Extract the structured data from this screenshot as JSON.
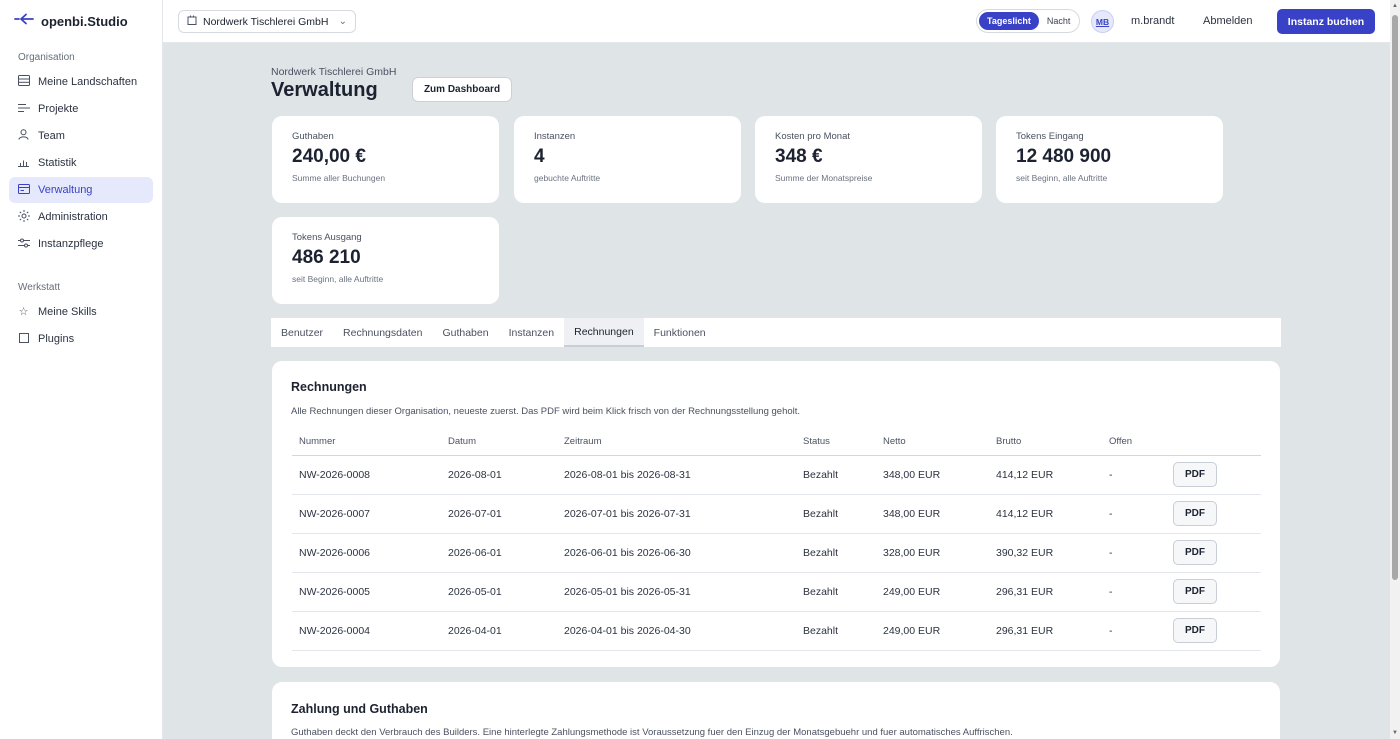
{
  "brand": {
    "logo_icon": "openbi-logo-icon",
    "name": "openbi.Studio"
  },
  "sidebar": {
    "section_org": "Organisation",
    "org_items": [
      {
        "label": "Meine Landschaften",
        "icon": "landscape-icon"
      },
      {
        "label": "Projekte",
        "icon": "projects-icon"
      },
      {
        "label": "Team",
        "icon": "user-icon"
      },
      {
        "label": "Statistik",
        "icon": "chart-icon"
      },
      {
        "label": "Verwaltung",
        "icon": "admin-card-icon",
        "active": true
      },
      {
        "label": "Administration",
        "icon": "sun-icon"
      },
      {
        "label": "Instanzpflege",
        "icon": "sliders-icon"
      }
    ],
    "section_workshop": "Werkstatt",
    "workshop_items": [
      {
        "label": "Meine Skills",
        "icon": "star-icon"
      },
      {
        "label": "Plugins",
        "icon": "square-icon"
      }
    ]
  },
  "header": {
    "org_select": "Nordwerk Tischlerei GmbH",
    "theme_day": "Tageslicht",
    "theme_night": "Nacht",
    "avatar": "MB",
    "username": "m.brandt",
    "logout": "Abmelden",
    "book_instance": "Instanz buchen"
  },
  "page": {
    "org_name": "Nordwerk Tischlerei GmbH",
    "title": "Verwaltung",
    "dashboard_button": "Zum Dashboard"
  },
  "stats": [
    {
      "label": "Guthaben",
      "value": "240,00 €",
      "sub": "Summe aller Buchungen"
    },
    {
      "label": "Instanzen",
      "value": "4",
      "sub": "gebuchte Auftritte"
    },
    {
      "label": "Kosten pro Monat",
      "value": "348 €",
      "sub": "Summe der Monatspreise"
    },
    {
      "label": "Tokens Eingang",
      "value": "12 480 900",
      "sub": "seit Beginn, alle Auftritte"
    },
    {
      "label": "Tokens Ausgang",
      "value": "486 210",
      "sub": "seit Beginn, alle Auftritte"
    }
  ],
  "tabs": [
    {
      "label": "Benutzer"
    },
    {
      "label": "Rechnungsdaten"
    },
    {
      "label": "Guthaben"
    },
    {
      "label": "Instanzen"
    },
    {
      "label": "Rechnungen",
      "active": true
    },
    {
      "label": "Funktionen"
    }
  ],
  "invoices": {
    "title": "Rechnungen",
    "description": "Alle Rechnungen dieser Organisation, neueste zuerst. Das PDF wird beim Klick frisch von der Rechnungsstellung geholt.",
    "columns": [
      "Nummer",
      "Datum",
      "Zeitraum",
      "Status",
      "Netto",
      "Brutto",
      "Offen",
      ""
    ],
    "pdf_label": "PDF",
    "rows": [
      [
        "NW-2026-0008",
        "2026-08-01",
        "2026-08-01 bis 2026-08-31",
        "Bezahlt",
        "348,00 EUR",
        "414,12 EUR",
        "-"
      ],
      [
        "NW-2026-0007",
        "2026-07-01",
        "2026-07-01 bis 2026-07-31",
        "Bezahlt",
        "348,00 EUR",
        "414,12 EUR",
        "-"
      ],
      [
        "NW-2026-0006",
        "2026-06-01",
        "2026-06-01 bis 2026-06-30",
        "Bezahlt",
        "328,00 EUR",
        "390,32 EUR",
        "-"
      ],
      [
        "NW-2026-0005",
        "2026-05-01",
        "2026-05-01 bis 2026-05-31",
        "Bezahlt",
        "249,00 EUR",
        "296,31 EUR",
        "-"
      ],
      [
        "NW-2026-0004",
        "2026-04-01",
        "2026-04-01 bis 2026-04-30",
        "Bezahlt",
        "249,00 EUR",
        "296,31 EUR",
        "-"
      ]
    ]
  },
  "payment": {
    "title": "Zahlung und Guthaben",
    "description": "Guthaben deckt den Verbrauch des Builders. Eine hinterlegte Zahlungsmethode ist Voraussetzung fuer den Einzug der Monatsgebuehr und fuer automatisches Auffrischen."
  },
  "colors": {
    "accent": "#3942c6",
    "background": "#dfe4e7",
    "card": "#ffffff"
  }
}
